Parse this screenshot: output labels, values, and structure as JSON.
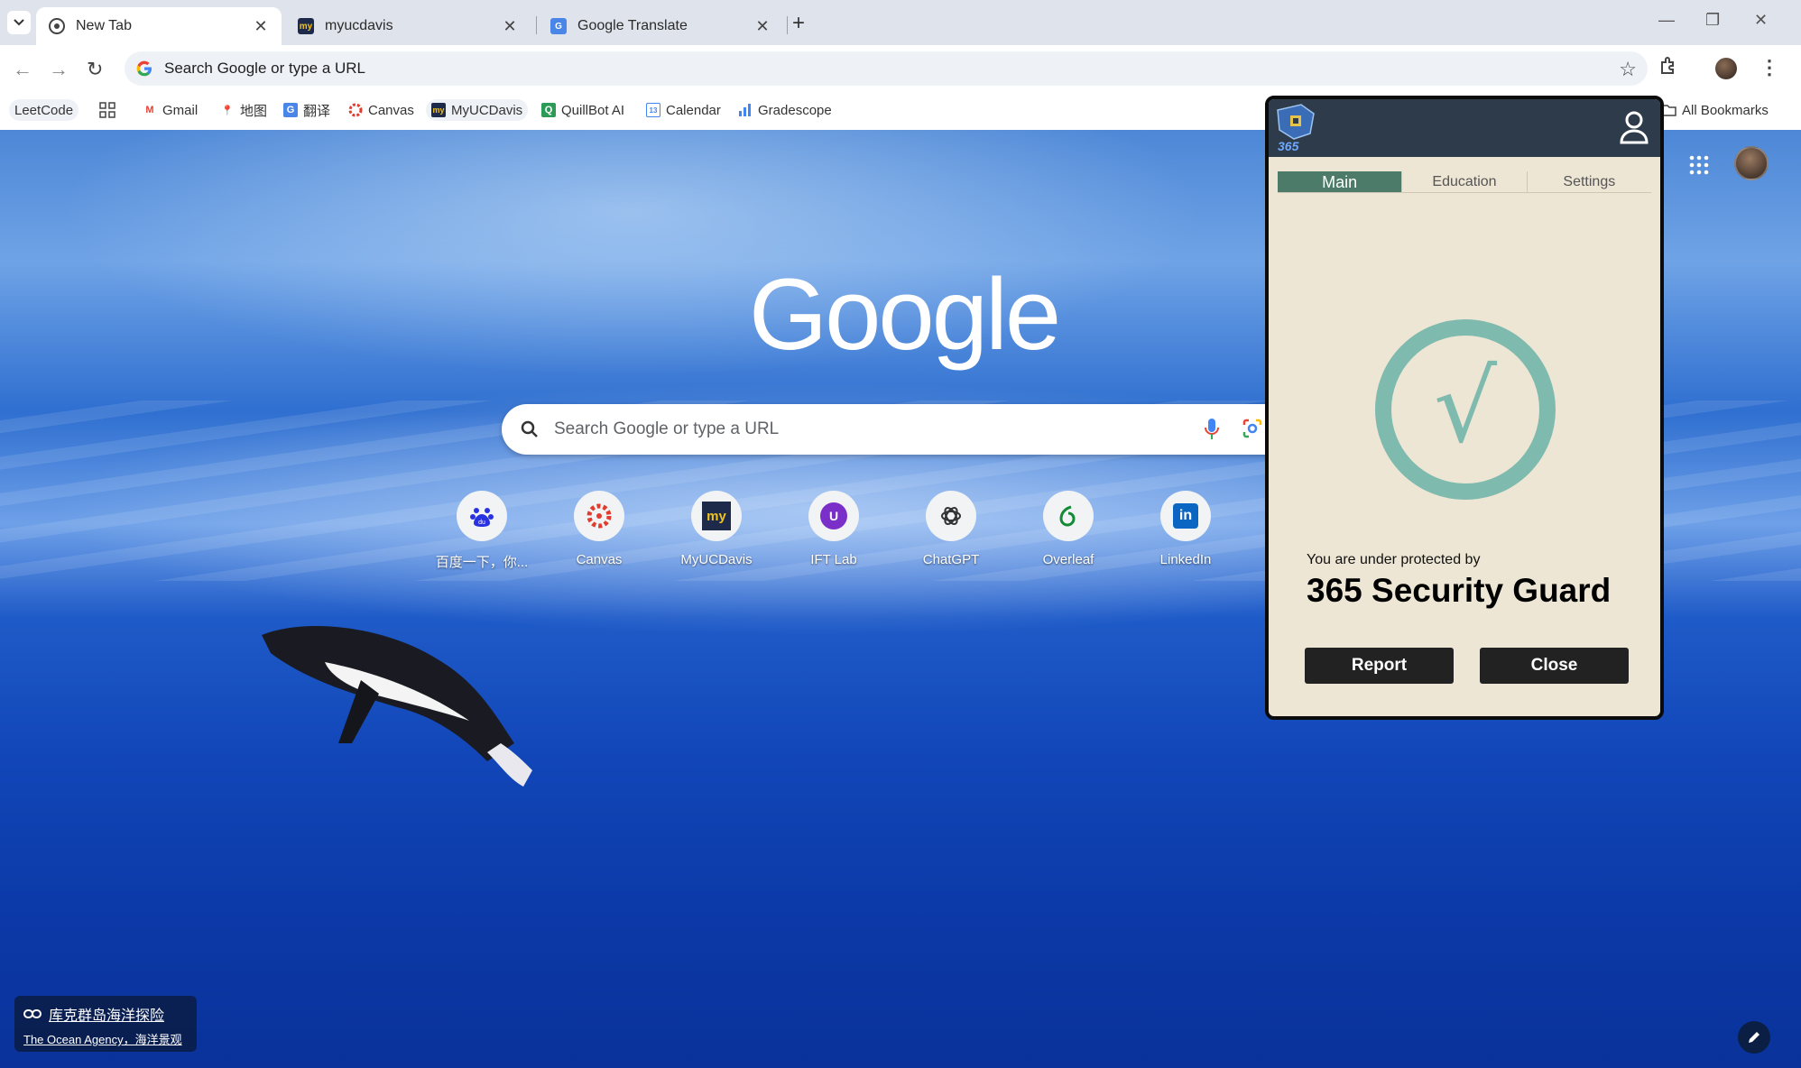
{
  "browser": {
    "tabs": [
      {
        "title": "New Tab",
        "icon": "chrome-icon",
        "active": true
      },
      {
        "title": "myucdavis",
        "icon": "myucdavis-icon",
        "active": false
      },
      {
        "title": "Google Translate",
        "icon": "translate-icon",
        "active": false
      }
    ],
    "omnibox_text": "Search Google or type a URL"
  },
  "bookmarks": [
    {
      "label": "LeetCode",
      "icon": ""
    },
    {
      "label": "",
      "icon": "apps-grid-icon"
    },
    {
      "label": "Gmail",
      "icon": "gmail-icon"
    },
    {
      "label": "地图",
      "icon": "maps-icon"
    },
    {
      "label": "翻译",
      "icon": "translate-icon"
    },
    {
      "label": "Canvas",
      "icon": "canvas-icon"
    },
    {
      "label": "MyUCDavis",
      "icon": "myucdavis-icon"
    },
    {
      "label": "QuillBot AI",
      "icon": "quillbot-icon"
    },
    {
      "label": "Calendar",
      "icon": "calendar-icon"
    },
    {
      "label": "Gradescope",
      "icon": "gradescope-icon"
    },
    {
      "label": "All Bookmarks",
      "icon": "folder-icon"
    }
  ],
  "ntp": {
    "logo_text": "Google",
    "search_placeholder": "Search Google or type a URL",
    "shortcuts": [
      {
        "label": "百度一下，你...",
        "icon": "baidu-icon"
      },
      {
        "label": "Canvas",
        "icon": "canvas-icon"
      },
      {
        "label": "MyUCDavis",
        "icon": "myucdavis-icon"
      },
      {
        "label": "IFT Lab",
        "icon": "ift-lab-icon",
        "letter": "U"
      },
      {
        "label": "ChatGPT",
        "icon": "chatgpt-icon"
      },
      {
        "label": "Overleaf",
        "icon": "overleaf-icon"
      },
      {
        "label": "LinkedIn",
        "icon": "linkedin-icon"
      }
    ],
    "attribution": {
      "title": "库克群岛海洋探险",
      "credit": "The Ocean Agency，海洋景观"
    }
  },
  "popup": {
    "logo_text": "365",
    "tabs": [
      "Main",
      "Education",
      "Settings"
    ],
    "active_tab": "Main",
    "status_symbol": "√",
    "protected_text": "You are under protected by",
    "product_name": "365 Security Guard",
    "report_label": "Report",
    "close_label": "Close",
    "colors": {
      "header": "#2d3b4b",
      "body": "#ede6d4",
      "accent": "#7fbaaf",
      "active_tab": "#4d7b6a"
    }
  }
}
